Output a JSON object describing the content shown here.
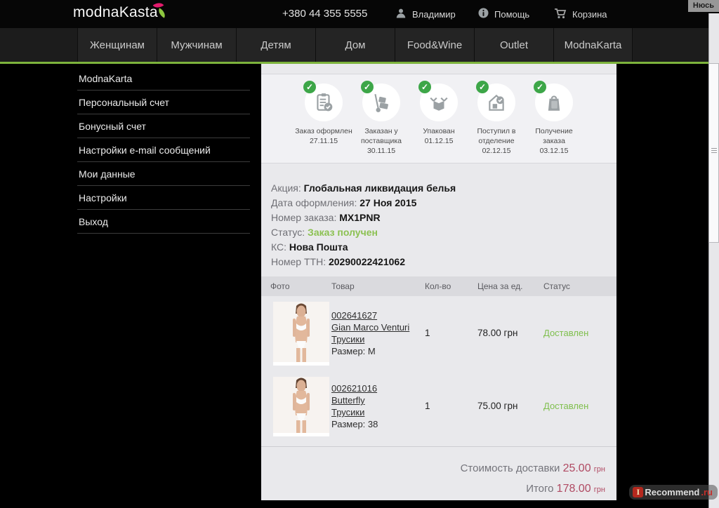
{
  "header": {
    "logo": "modnaKasta",
    "phone": "+380 44 355 5555",
    "user_label": "Владимир",
    "help_label": "Помощь",
    "cart_label": "Корзина",
    "overlay_tab": "Нюсь"
  },
  "nav": {
    "items": [
      "Женщинам",
      "Мужчинам",
      "Детям",
      "Дом",
      "Food&Wine",
      "Outlet",
      "ModnaKarta"
    ]
  },
  "sidebar": {
    "items": [
      "ModnaKarta",
      "Персональный счет",
      "Бонусный счет",
      "Настройки e-mail сообщений",
      "Мои данные",
      "Настройки",
      "Выход"
    ]
  },
  "tracker": {
    "steps": [
      {
        "title": "Заказ оформлен",
        "date": "27.11.15",
        "icon": "order-note-icon"
      },
      {
        "title": "Заказан у поставщика",
        "date": "30.11.15",
        "icon": "handtruck-icon"
      },
      {
        "title": "Упакован",
        "date": "01.12.15",
        "icon": "open-box-icon"
      },
      {
        "title": "Поступил в отделение",
        "date": "02.12.15",
        "icon": "warehouse-check-icon"
      },
      {
        "title": "Получение заказа",
        "date": "03.12.15",
        "icon": "shopping-bag-icon"
      }
    ]
  },
  "order": {
    "promo_label": "Акция:",
    "promo_value": "Глобальная ликвидация белья",
    "date_label": "Дата оформления:",
    "date_value": "27 Ноя 2015",
    "number_label": "Номер заказа:",
    "number_value": "MX1PNR",
    "status_label": "Статус:",
    "status_value": "Заказ получен",
    "carrier_label": "КС:",
    "carrier_value": "Нова Пошта",
    "ttn_label": "Номер ТТН:",
    "ttn_value": "20290022421062"
  },
  "items_table": {
    "headers": [
      "Фото",
      "Товар",
      "Кол-во",
      "Цена за ед.",
      "Статус"
    ],
    "rows": [
      {
        "sku": "002641627",
        "brand": "Gian Marco Venturi",
        "product": "Трусики",
        "size": "Размер: M",
        "qty": "1",
        "price": "78.00 грн",
        "status": "Доставлен"
      },
      {
        "sku": "002621016",
        "brand": "Butterfly",
        "product": "Трусики",
        "size": "Размер: 38",
        "qty": "1",
        "price": "75.00 грн",
        "status": "Доставлен"
      }
    ]
  },
  "totals": {
    "delivery_label": "Стоимость доставки",
    "delivery_value": "25.00",
    "delivery_currency": "грн",
    "total_label": "Итого",
    "total_value": "178.00",
    "total_currency": "грн"
  },
  "icons": {
    "check_glyph": "✓"
  },
  "watermark": {
    "icon": "I",
    "name": "Recommend",
    "tld": ".ru"
  },
  "colors": {
    "accent_green": "#7db33c",
    "status_green": "#7fbf4d",
    "price_red": "#b04a63",
    "brand_pink": "#e31b6d",
    "brand_green": "#8dc63f"
  }
}
